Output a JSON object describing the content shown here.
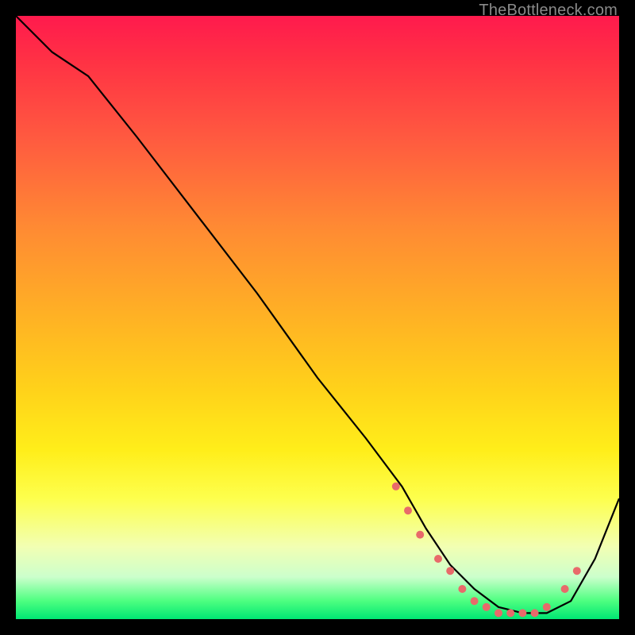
{
  "watermark": "TheBottleneck.com",
  "chart_data": {
    "type": "line",
    "title": "",
    "xlabel": "",
    "ylabel": "",
    "xlim": [
      0,
      100
    ],
    "ylim": [
      0,
      100
    ],
    "series": [
      {
        "name": "curve",
        "x": [
          0,
          6,
          12,
          20,
          30,
          40,
          50,
          58,
          64,
          68,
          72,
          76,
          80,
          84,
          88,
          92,
          96,
          100
        ],
        "y": [
          100,
          94,
          90,
          80,
          67,
          54,
          40,
          30,
          22,
          15,
          9,
          5,
          2,
          1,
          1,
          3,
          10,
          20
        ]
      }
    ],
    "markers": {
      "name": "dots",
      "x": [
        63,
        65,
        67,
        70,
        72,
        74,
        76,
        78,
        80,
        82,
        84,
        86,
        88,
        91,
        93
      ],
      "y": [
        22,
        18,
        14,
        10,
        8,
        5,
        3,
        2,
        1,
        1,
        1,
        1,
        2,
        5,
        8
      ],
      "color": "#e86a6a",
      "radius": 5
    },
    "colors": {
      "curve": "#000000",
      "dots": "#e86a6a"
    }
  }
}
